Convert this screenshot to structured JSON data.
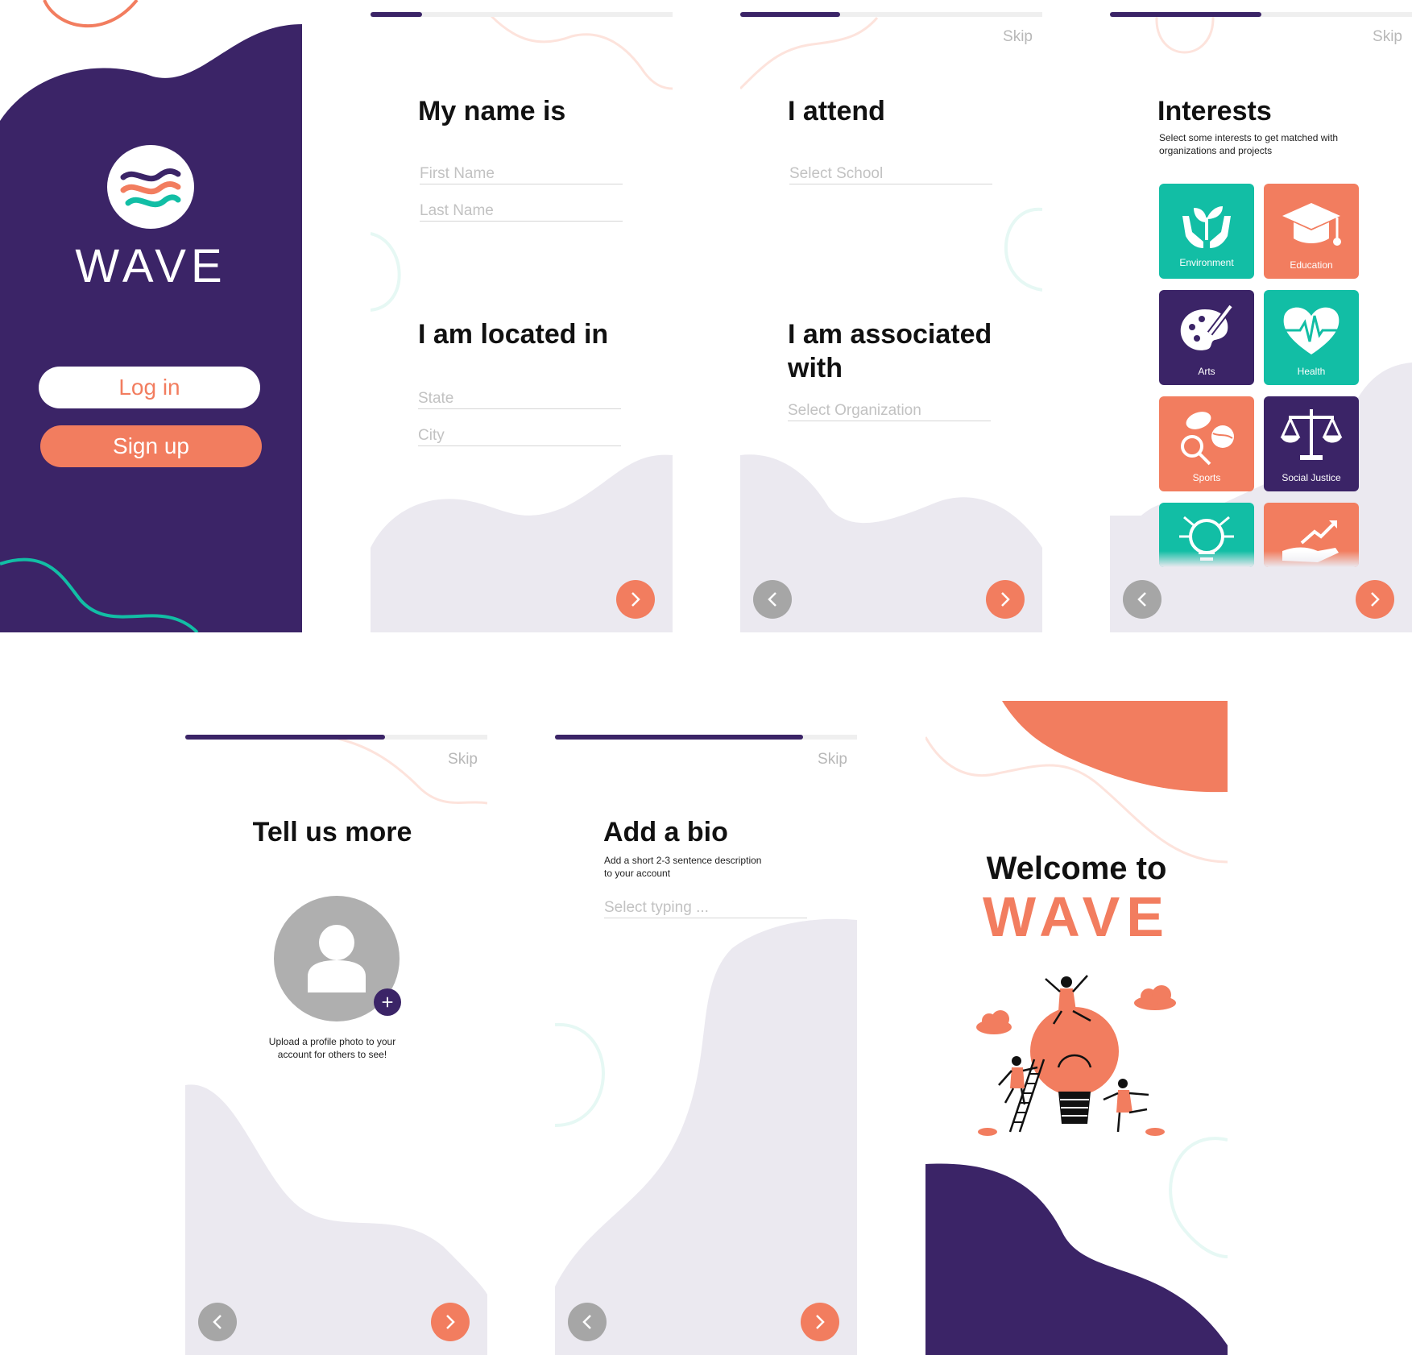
{
  "colors": {
    "purple": "#3b2467",
    "orange": "#f27d5f",
    "teal": "#12bea5",
    "light": "#ebe9f0",
    "gray": "#a6a6a6"
  },
  "login": {
    "logo_text": "WAVE",
    "login_label": "Log in",
    "signup_label": "Sign up"
  },
  "name_screen": {
    "progress": 0.17,
    "title": "My name is",
    "first_name_placeholder": "First Name",
    "last_name_placeholder": "Last Name",
    "location_title": "I am located in",
    "state_placeholder": "State",
    "city_placeholder": "City"
  },
  "school_screen": {
    "progress": 0.33,
    "skip_label": "Skip",
    "title": "I attend",
    "school_placeholder": "Select School",
    "assoc_title": "I am associated with",
    "org_placeholder": "Select Organization"
  },
  "interests_screen": {
    "progress": 0.5,
    "skip_label": "Skip",
    "title": "Interests",
    "subtitle": "Select some interests to get matched with organizations and projects",
    "tiles": [
      {
        "label": "Environment",
        "color": "teal",
        "icon": "plant-hands-icon"
      },
      {
        "label": "Education",
        "color": "orange",
        "icon": "graduation-cap-icon"
      },
      {
        "label": "Arts",
        "color": "purple",
        "icon": "palette-icon"
      },
      {
        "label": "Health",
        "color": "teal",
        "icon": "heartbeat-icon"
      },
      {
        "label": "Sports",
        "color": "orange",
        "icon": "sports-balls-icon"
      },
      {
        "label": "Social Justice",
        "color": "purple",
        "icon": "scales-icon"
      },
      {
        "label": "",
        "color": "teal",
        "icon": "lightbulb-circuit-icon"
      },
      {
        "label": "",
        "color": "orange",
        "icon": "hand-growth-icon"
      }
    ]
  },
  "more_screen": {
    "progress": 0.66,
    "skip_label": "Skip",
    "title": "Tell us more",
    "upload_text_1": "Upload a profile photo to your",
    "upload_text_2": "account for others to see!"
  },
  "bio_screen": {
    "progress": 0.82,
    "skip_label": "Skip",
    "title": "Add a bio",
    "subtitle_1": "Add a short 2-3 sentence description",
    "subtitle_2": "to your account",
    "bio_placeholder": "Select typing ..."
  },
  "welcome_screen": {
    "line1": "Welcome to",
    "line2": "WAVE"
  }
}
